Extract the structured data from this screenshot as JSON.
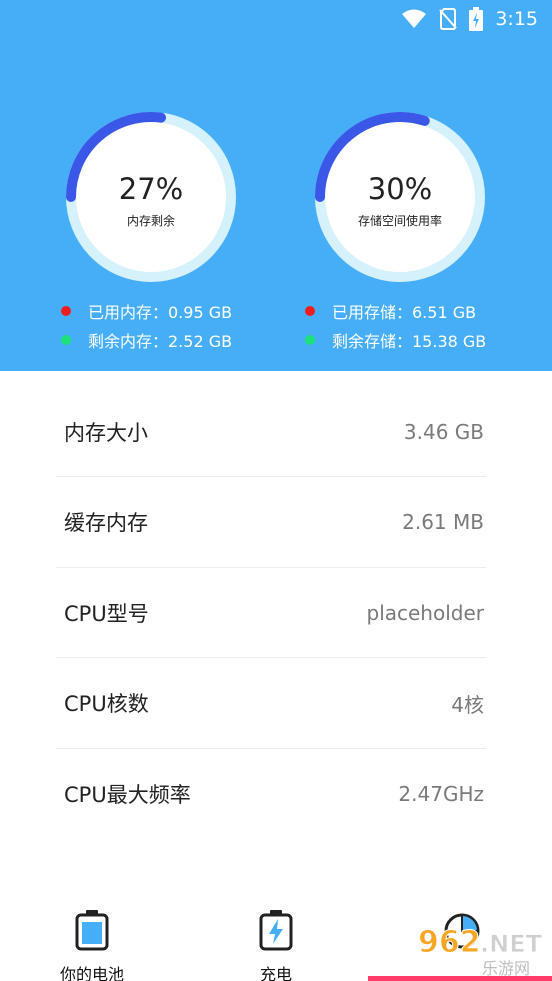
{
  "status_bar": {
    "time": "3:15"
  },
  "memory_gauge": {
    "percent": "27%",
    "caption": "内存剩余",
    "fraction": 0.27,
    "arc_color": "#3a57e8",
    "ring_color": "#d5f1fb"
  },
  "storage_gauge": {
    "percent": "30%",
    "caption": "存储空间使用率",
    "fraction": 0.3,
    "arc_color": "#3a57e8",
    "ring_color": "#d5f1fb"
  },
  "memory_legend": [
    {
      "text": "已用内存：0.95 GB",
      "color": "#f01c1c"
    },
    {
      "text": "剩余内存：2.52 GB",
      "color": "#1de27a"
    }
  ],
  "storage_legend": [
    {
      "text": "已用存储：6.51 GB",
      "color": "#f01c1c"
    },
    {
      "text": "剩余存储：15.38 GB",
      "color": "#1de27a"
    }
  ],
  "info_rows": [
    {
      "label": "内存大小",
      "value": "3.46 GB"
    },
    {
      "label": "缓存内存",
      "value": "2.61 MB"
    },
    {
      "label": "CPU型号",
      "value": "placeholder"
    },
    {
      "label": "CPU核数",
      "value": "4核"
    },
    {
      "label": "CPU最大频率",
      "value": "2.47GHz"
    }
  ],
  "bottom_nav": [
    {
      "label": "你的电池",
      "icon": "battery-icon"
    },
    {
      "label": "充电",
      "icon": "charging-icon"
    },
    {
      "label": "",
      "icon": "pie-chart-icon"
    }
  ],
  "watermark": {
    "text": "962.NET",
    "subtext": "乐游网"
  },
  "colors": {
    "header_bg": "#46aef7",
    "accent": "#3a57e8"
  }
}
